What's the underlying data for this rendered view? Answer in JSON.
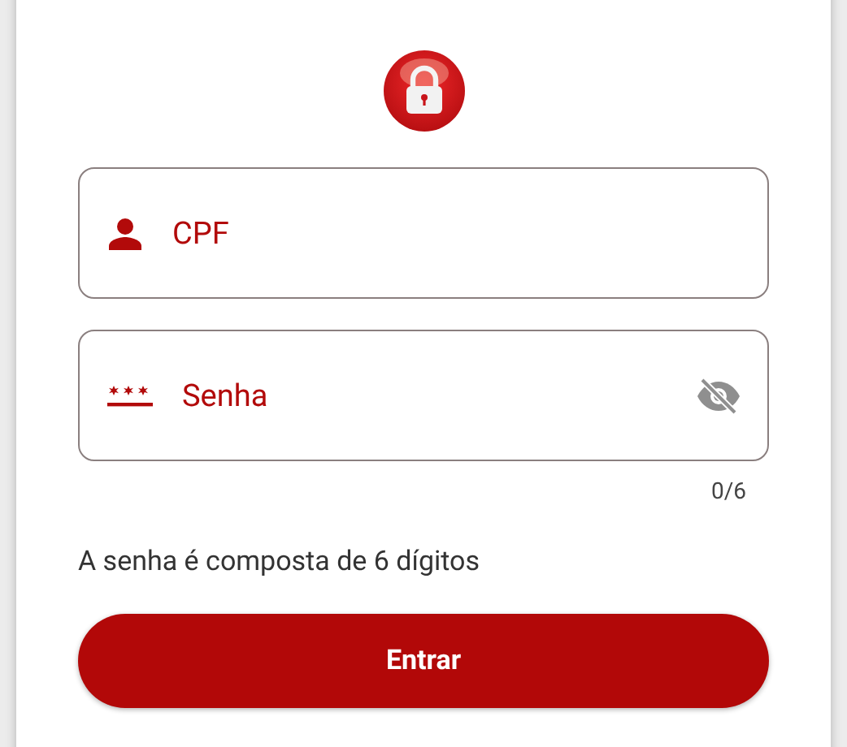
{
  "fields": [
    {
      "kind": "user",
      "placeholder": "CPF"
    },
    {
      "kind": "password",
      "placeholder": "Senha",
      "counter": "0/6"
    }
  ],
  "hint": "A senha é composta de 6 dígitos",
  "submit": {
    "label": "Entrar"
  }
}
